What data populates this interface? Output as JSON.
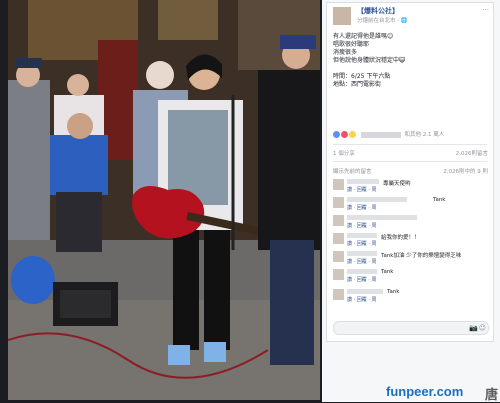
{
  "post": {
    "page_name": "【爆料公社】",
    "meta": "分鐘前在台北市 · 🌐",
    "menu": "···",
    "body_lines": [
      "有人還記得他是誰嗎😊",
      "唱歌很好聽耶",
      "消瘦很多",
      "但他說他身體狀況穩定中😺",
      "",
      "時間：6/25 下午六點",
      "地點：西門電影街"
    ]
  },
  "reactions": {
    "suffix": "和其他 2.1 萬人"
  },
  "share_row": {
    "left": "1 個分享",
    "right": "2,026則留言"
  },
  "comments_sort": {
    "left": "顯示先前的留言",
    "right": "2,026則中的 9 則"
  },
  "comments": [
    {
      "text": "專屬天使哟",
      "actions": "讚 · 回覆 · 周"
    },
    {
      "text": "Tank",
      "actions": "讚 · 回覆 · 周"
    },
    {
      "text": "",
      "actions": "讚 · 回覆 · 周"
    },
    {
      "text": "給我你的愛！！",
      "actions": "讚 · 回覆 · 周"
    },
    {
      "text": "Tank加油 少了你的樂壇變得乏味",
      "actions": "讚 · 回覆 · 周"
    },
    {
      "text": "Tank",
      "actions": "讚 · 回覆 · 周"
    },
    {
      "text": "Tank",
      "actions": "讚 · 回覆 · 周"
    }
  ],
  "colors": {
    "link": "#365899",
    "like": "#5890ff",
    "love": "#f25268",
    "haha": "#fcd34d",
    "watermark": "#1e6fb8"
  },
  "icons": [
    "camera-icon",
    "emoji-icon",
    "like-reaction-icon",
    "love-reaction-icon",
    "haha-reaction-icon"
  ],
  "watermark": {
    "text": "funpeer.com",
    "char": "唐"
  }
}
